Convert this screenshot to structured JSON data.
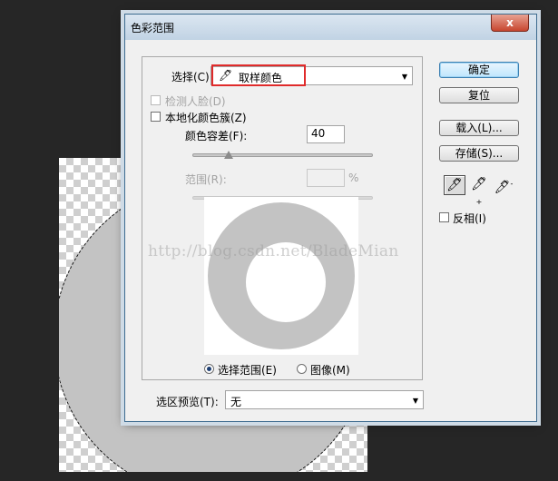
{
  "dialog": {
    "title": "色彩范围",
    "close_label": "x"
  },
  "select": {
    "label": "选择(C):",
    "value": "取样颜色",
    "eyedropper_icon": "eyedropper-icon"
  },
  "detect_faces": {
    "label": "检测人脸(D)",
    "checked": false,
    "enabled": false
  },
  "localized_clusters": {
    "label": "本地化颜色簇(Z)",
    "checked": false
  },
  "fuzziness": {
    "label": "颜色容差(F):",
    "value": "40",
    "slider_fraction": 0.2
  },
  "range": {
    "label": "范围(R):",
    "value": "",
    "unit": "%"
  },
  "preview_mode": {
    "selection_label": "选择范围(E)",
    "image_label": "图像(M)",
    "selected": "selection"
  },
  "selection_preview": {
    "label": "选区预览(T):",
    "value": "无"
  },
  "buttons": {
    "ok": "确定",
    "reset": "复位",
    "load": "载入(L)...",
    "save": "存储(S)..."
  },
  "eyedropper_tools": [
    "eyedropper-icon",
    "eyedropper-plus-icon",
    "eyedropper-minus-icon"
  ],
  "invert": {
    "label": "反相(I)",
    "checked": false
  },
  "watermark": "http://blog.csdn.net/BladeMian",
  "colors": {
    "highlight": "#e02b2b",
    "ring": "#c3c3c3",
    "dialog_bg": "#f0f0f0",
    "page_bg": "#262626"
  }
}
